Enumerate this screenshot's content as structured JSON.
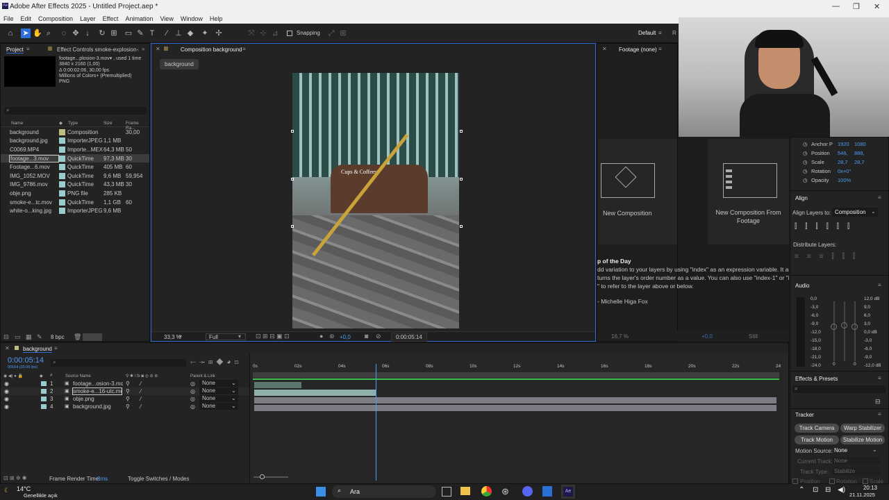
{
  "titlebar": {
    "title": "Adobe After Effects 2025 - Untitled Project.aep *",
    "min": "—",
    "max": "❐",
    "close": "✕"
  },
  "menu": [
    "File",
    "Edit",
    "Composition",
    "Layer",
    "Effect",
    "Animation",
    "View",
    "Window",
    "Help"
  ],
  "toolbar": {
    "snapping": "Snapping",
    "workspace": "Default",
    "extra": "R"
  },
  "project": {
    "tab": "Project",
    "effect_tab": "Effect Controls smoke-explosion-202",
    "preview_lines": [
      "footage...plosion-3.mov▾ , used 1 time",
      "3840 x 2160 (1,00)",
      "Δ 0:00:02:06, 30,00 fps",
      "Millions of Colors+ (Premultiplied)",
      "PNG"
    ],
    "search_placeholder": "",
    "columns": [
      "Name",
      "Type",
      "Size",
      "Frame Ra..."
    ],
    "items": [
      {
        "name": "background",
        "type": "Composition",
        "size": "",
        "fr": "30,00",
        "color": "#bdbd80"
      },
      {
        "name": "background.jpg",
        "type": "ImporterJPEG",
        "size": "1,1 MB",
        "fr": "",
        "color": "#9cb8c8"
      },
      {
        "name": "C0069.MP4",
        "type": "Importe...MEX",
        "size": "64,3 MB",
        "fr": "50",
        "color": "#9cb8c8"
      },
      {
        "name": "footage...3.mov",
        "type": "QuickTime",
        "size": "97,3 MB",
        "fr": "30",
        "color": "#9cb8c8"
      },
      {
        "name": "Footage...6.mov",
        "type": "QuickTime",
        "size": "405 MB",
        "fr": "60",
        "color": "#9cb8c8"
      },
      {
        "name": "IMG_1052.MOV",
        "type": "QuickTime",
        "size": "9,6 MB",
        "fr": "59,954",
        "color": "#9cb8c8"
      },
      {
        "name": "IMG_9786.mov",
        "type": "QuickTime",
        "size": "43,3 MB",
        "fr": "30",
        "color": "#9cb8c8"
      },
      {
        "name": "obje.png",
        "type": "PNG file",
        "size": "285 KB",
        "fr": "",
        "color": "#9cb8c8"
      },
      {
        "name": "smoke-e...tc.mov",
        "type": "QuickTime",
        "size": "1,1 GB",
        "fr": "60",
        "color": "#9cb8c8"
      },
      {
        "name": "white-o...king.jpg",
        "type": "ImporterJPEG",
        "size": "9,6 MB",
        "fr": "",
        "color": "#9cb8c8"
      }
    ],
    "bpc": "8 bpc"
  },
  "comp": {
    "tab": "Composition background",
    "crumb": "background",
    "sign": "Cups & Coffees",
    "zoom": "33,3 %",
    "res": "Full",
    "exposure": "+0,0",
    "time": "0:00:05:14"
  },
  "footage": {
    "tab": "Footage (none)",
    "new_comp": "New Composition",
    "new_comp_footage": "New Composition From Footage",
    "tip_title": "p of the Day",
    "tip_lines": [
      "dd variation to your layers by using \"index\" as an expression variable. It al",
      "turns the layer's order number as a value. You can also use \"index-1\" or \"i",
      "\" to refer to the layer above or below."
    ],
    "tip_author": "- Michelle Higa Fox",
    "zoom": "16,7 %",
    "exposure": "+0,0",
    "still": "Still"
  },
  "props": [
    {
      "label": "Anchor P",
      "v1": "1920",
      "v2": "1080"
    },
    {
      "label": "Position",
      "v1": "546,",
      "v2": "888,"
    },
    {
      "label": "Scale",
      "v1": "28,7",
      "v2": "28,7"
    },
    {
      "label": "Rotation",
      "v1": "0x+0°",
      "v2": ""
    },
    {
      "label": "Opacity",
      "v1": "100%",
      "v2": ""
    }
  ],
  "align": {
    "title": "Align",
    "to_label": "Align Layers to:",
    "to_value": "Composition",
    "distribute": "Distribute Layers:"
  },
  "audio": {
    "title": "Audio",
    "left": [
      "0,0",
      "-3,0",
      "-6,0",
      "-9,0",
      "-12,0",
      "-15,0",
      "-18,0",
      "-21,0",
      "-24,0"
    ],
    "right": [
      "12,0 dB",
      "9,0",
      "6,0",
      "3,0",
      "0,0 dB",
      "-3,0",
      "-6,0",
      "-9,0",
      "-12,0 dB"
    ],
    "zero1": "0",
    "zero2": "0"
  },
  "effects": {
    "title": "Effects & Presets"
  },
  "tracker": {
    "title": "Tracker",
    "b1": "Track Camera",
    "b2": "Warp Stabilizer",
    "b3": "Track Motion",
    "b4": "Stabilize Motion",
    "src_label": "Motion Source:",
    "src_value": "None",
    "cur_label": "Current Track:",
    "cur_value": "None",
    "type_label": "Track Type:",
    "type_value": "Stabilize",
    "pos": "Position",
    "rot": "Rotation",
    "scale": "Scale"
  },
  "timeline": {
    "tab": "background",
    "time": "0:00:05:14",
    "fps": "00164 (30.00 fps)",
    "src_col": "Source Name",
    "parent_col": "Parent & Link",
    "ruler": [
      "0s",
      "02s",
      "04s",
      "06s",
      "08s",
      "10s",
      "12s",
      "14s",
      "16s",
      "18s",
      "20s",
      "22s",
      "24"
    ],
    "layers": [
      {
        "n": "1",
        "name": "footage...osion-3.mov",
        "parent": "None"
      },
      {
        "n": "2",
        "name": "smoke-e...16-utc.mov",
        "parent": "None"
      },
      {
        "n": "3",
        "name": "obje.png",
        "parent": "None"
      },
      {
        "n": "4",
        "name": "background.jpg",
        "parent": "None"
      }
    ],
    "render_label": "Frame Render Time:",
    "render_val": "6ms",
    "toggle": "Toggle Switches / Modes",
    "playhead_pct": 0.234
  },
  "taskbar": {
    "temp": "14°C",
    "weather": "Genellikle açık",
    "search": "Ara",
    "time": "20:13",
    "date": "21.11.2025"
  }
}
